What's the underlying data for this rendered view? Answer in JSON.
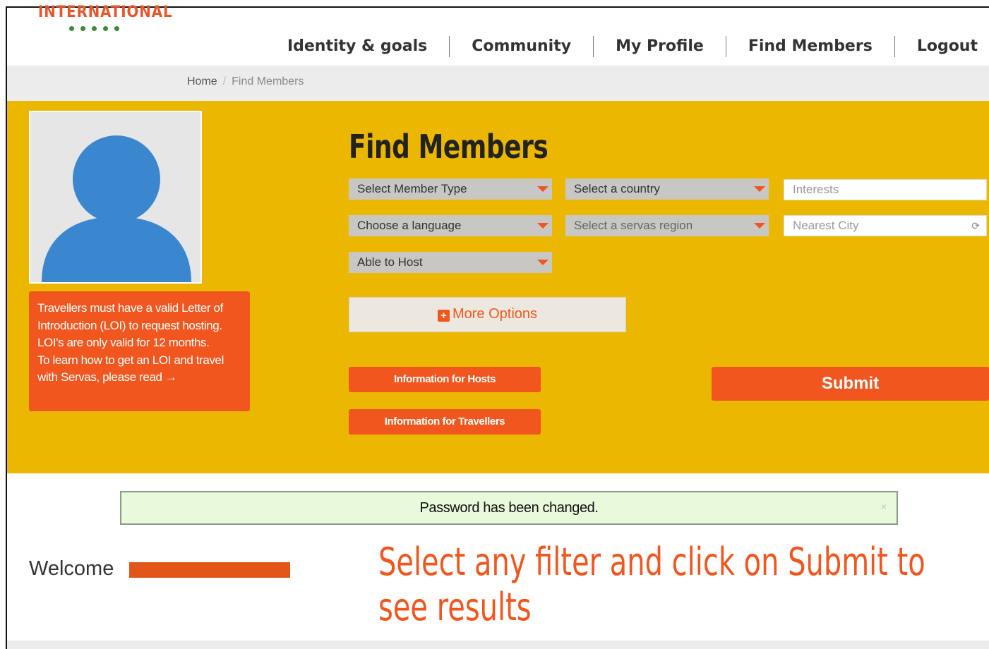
{
  "brand": {
    "logo_text": "INTERNATIONAL"
  },
  "nav": {
    "items": [
      "Identity & goals",
      "Community",
      "My Profile",
      "Find Members",
      "Logout"
    ]
  },
  "breadcrumb": {
    "home": "Home",
    "separator": "/",
    "current": "Find Members"
  },
  "sidebar": {
    "loi_line1": "Travellers must have a valid Letter of Introduction (LOI) to request hosting.",
    "loi_line2": "LOI's are only valid for 12 months.",
    "loi_line3": "To learn how to get an LOI and travel with Servas, please read →"
  },
  "search": {
    "title": "Find Members",
    "member_type": "Select Member Type",
    "country": "Select a country",
    "interests_placeholder": "Interests",
    "language": "Choose a language",
    "region": "Select a servas region",
    "city_placeholder": "Nearest City",
    "able_to_host": "Able to Host",
    "more_options": "More Options",
    "info_hosts": "Information for Hosts",
    "info_travellers": "Information for Travellers",
    "submit": "Submit"
  },
  "alert": {
    "message": "Password has been changed.",
    "close": "×"
  },
  "welcome": {
    "label": "Welcome"
  },
  "callout": {
    "text": "Select any filter and click on Submit to see results"
  },
  "colors": {
    "accent": "#f0561e",
    "panel": "#ebb700",
    "alert_bg": "#e9f9dc"
  },
  "icons": {
    "plus": "plus-square-icon",
    "caret": "caret-down-icon",
    "refresh": "refresh-icon"
  }
}
